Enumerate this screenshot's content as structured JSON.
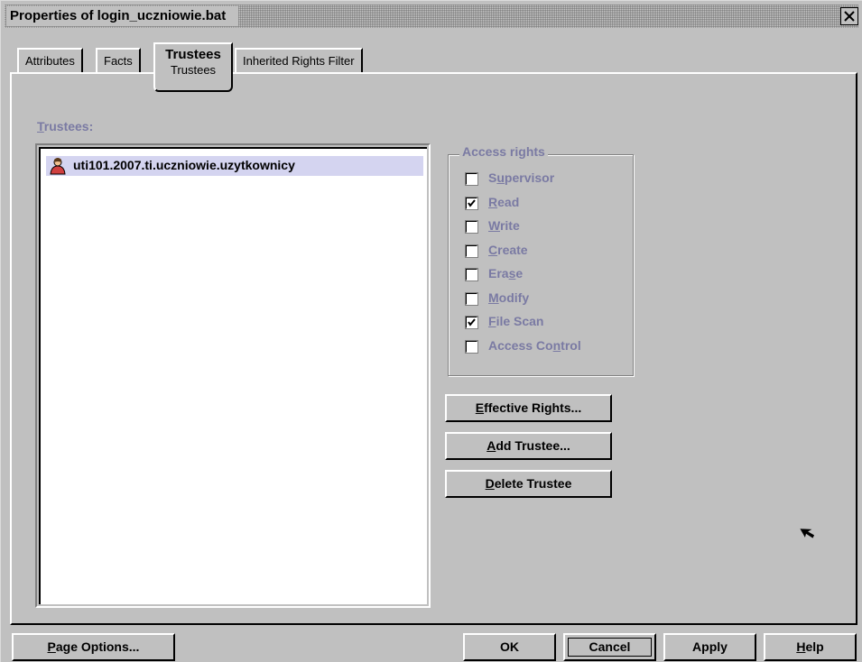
{
  "dialog": {
    "title": "Properties of login_uczniowie.bat"
  },
  "tabs": [
    {
      "label": "Attributes"
    },
    {
      "label": "Facts"
    },
    {
      "label": "Trustees",
      "sub_label": "Trustees",
      "active": true
    },
    {
      "label": "Inherited Rights Filter"
    }
  ],
  "trustees": {
    "label_mnemonic": "T",
    "label_rest": "rustees:",
    "items": [
      {
        "name": "uti101.2007.ti.uczniowie.uzytkownicy",
        "icon": "user-icon",
        "selected": true
      }
    ]
  },
  "access_rights": {
    "title": "Access rights",
    "items": [
      {
        "pre": "S",
        "mn": "u",
        "post": "pervisor",
        "checked": false
      },
      {
        "pre": "",
        "mn": "R",
        "post": "ead",
        "checked": true
      },
      {
        "pre": "",
        "mn": "W",
        "post": "rite",
        "checked": false
      },
      {
        "pre": "",
        "mn": "C",
        "post": "reate",
        "checked": false
      },
      {
        "pre": "Era",
        "mn": "s",
        "post": "e",
        "checked": false
      },
      {
        "pre": "",
        "mn": "M",
        "post": "odify",
        "checked": false
      },
      {
        "pre": "",
        "mn": "F",
        "post": "ile Scan",
        "checked": true
      },
      {
        "pre": "Access Co",
        "mn": "n",
        "post": "trol",
        "checked": false
      }
    ]
  },
  "buttons": {
    "effective_rights": {
      "mn": "E",
      "rest": "ffective Rights..."
    },
    "add_trustee": {
      "mn": "A",
      "rest": "dd Trustee..."
    },
    "delete_trustee": {
      "mn": "D",
      "rest": "elete Trustee"
    },
    "page_options": {
      "mn": "P",
      "rest": "age Options..."
    },
    "ok": "OK",
    "cancel": "Cancel",
    "apply": "Apply",
    "help": {
      "mn": "H",
      "rest": "elp"
    }
  },
  "colors": {
    "face": "#c0c0c0",
    "disabled_text": "#7a7aa3",
    "selection": "#d4d4f0"
  }
}
